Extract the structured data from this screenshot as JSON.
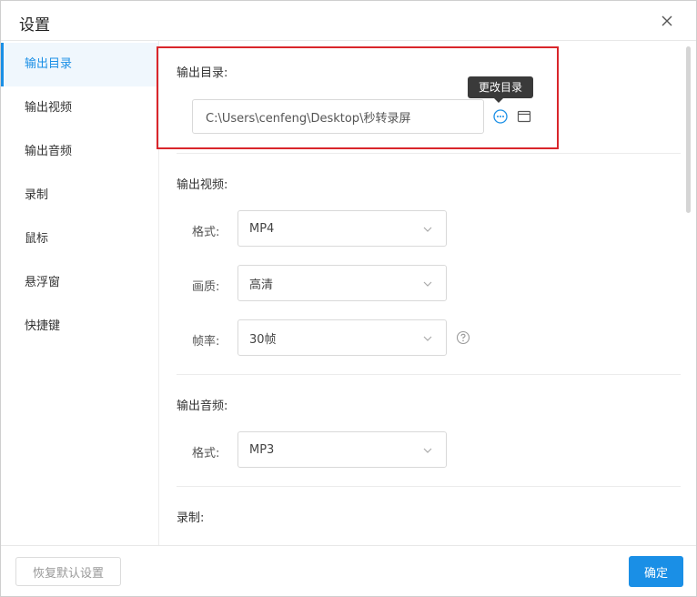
{
  "window": {
    "title": "设置"
  },
  "sidebar": {
    "items": [
      {
        "label": "输出目录",
        "active": true
      },
      {
        "label": "输出视频",
        "active": false
      },
      {
        "label": "输出音频",
        "active": false
      },
      {
        "label": "录制",
        "active": false
      },
      {
        "label": "鼠标",
        "active": false
      },
      {
        "label": "悬浮窗",
        "active": false
      },
      {
        "label": "快捷键",
        "active": false
      }
    ]
  },
  "output_dir": {
    "section_label": "输出目录:",
    "path": "C:\\Users\\cenfeng\\Desktop\\秒转录屏",
    "tooltip": "更改目录",
    "more_icon": "more-circle-icon",
    "folder_icon": "folder-icon"
  },
  "output_video": {
    "section_label": "输出视频:",
    "format_label": "格式:",
    "format_value": "MP4",
    "quality_label": "画质:",
    "quality_value": "高清",
    "fps_label": "帧率:",
    "fps_value": "30帧",
    "help_icon": "question-circle-icon"
  },
  "output_audio": {
    "section_label": "输出音频:",
    "format_label": "格式:",
    "format_value": "MP3"
  },
  "record": {
    "section_label": "录制:"
  },
  "footer": {
    "reset_label": "恢复默认设置",
    "confirm_label": "确定"
  },
  "colors": {
    "accent": "#1a8fe6",
    "highlight_border": "#d9262b"
  }
}
